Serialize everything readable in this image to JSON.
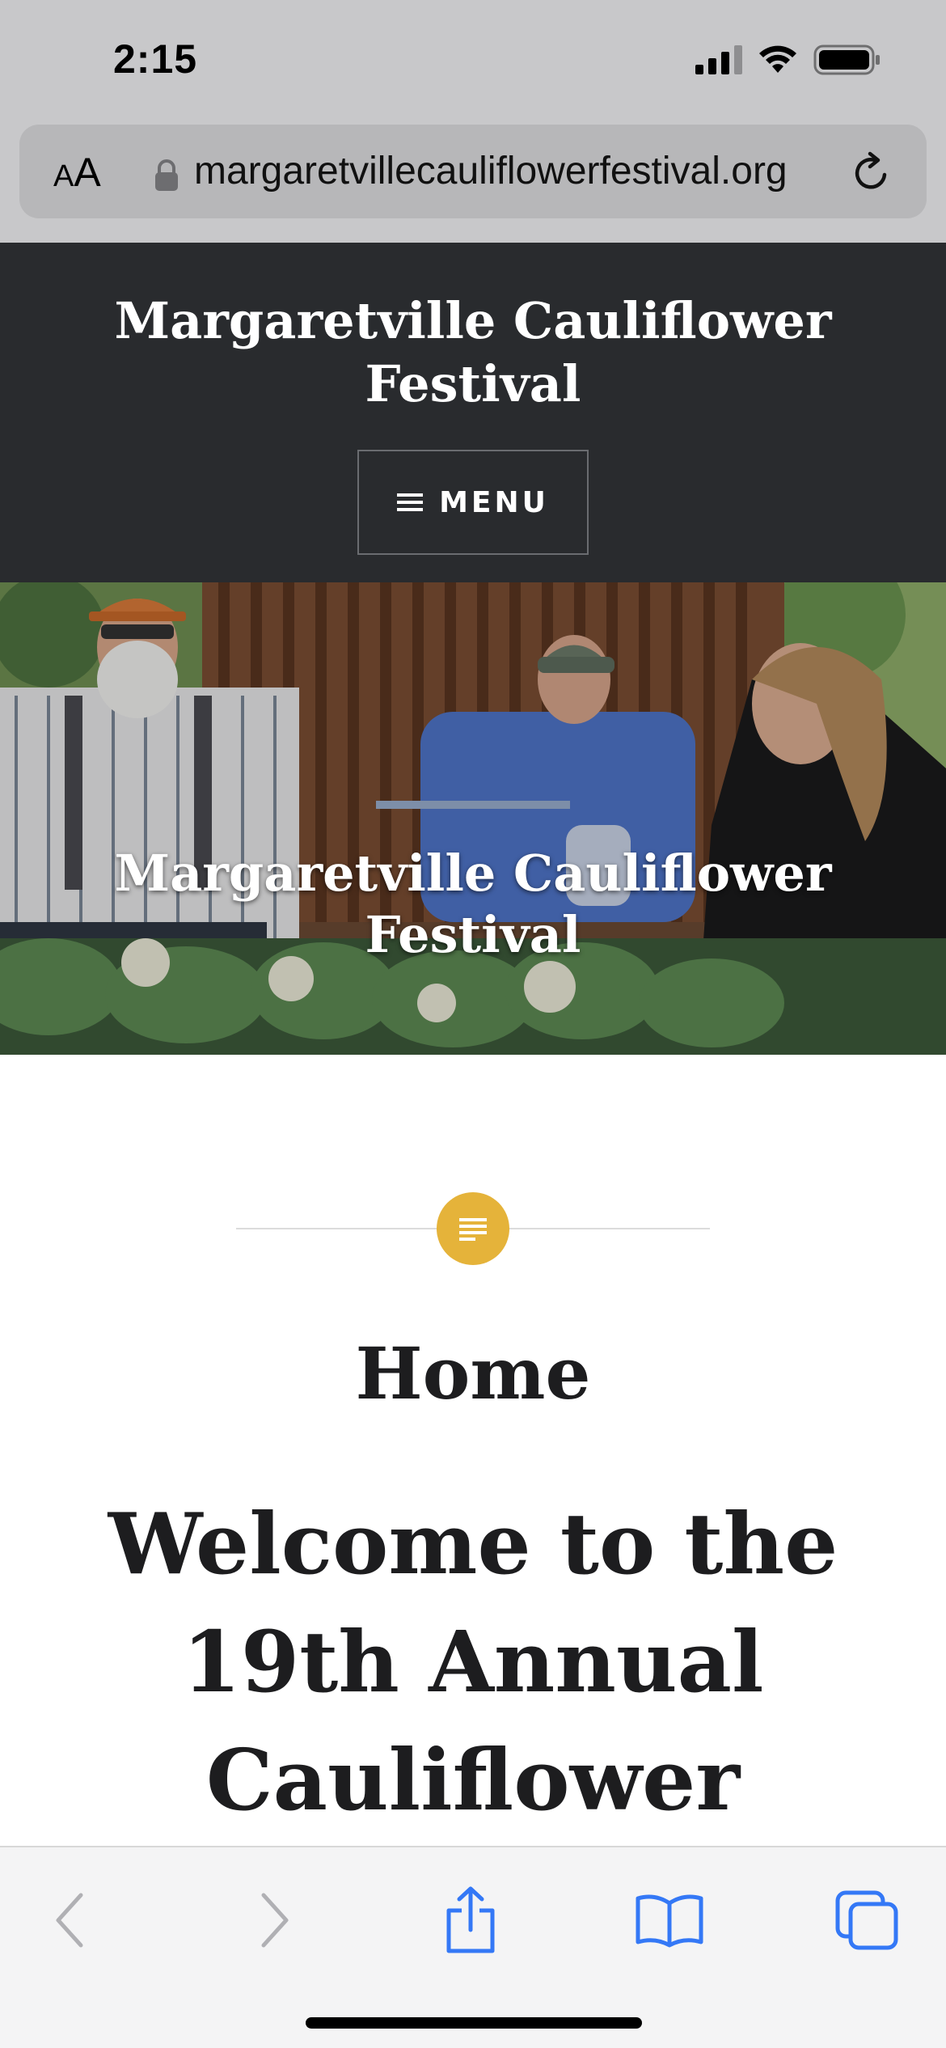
{
  "status_bar": {
    "time": "2:15",
    "icons": [
      "cellular-signal-icon",
      "wifi-icon",
      "battery-icon"
    ]
  },
  "browser": {
    "text_size_small": "A",
    "text_size_big": "A",
    "url": "margaretvillecauliflowerfestival.org",
    "icons": [
      "lock-icon",
      "reload-icon"
    ]
  },
  "site": {
    "title": "Margaretville Cauliflower Festival",
    "menu_label": "MENU",
    "menu_icon": "hamburger-icon"
  },
  "hero": {
    "title": "Margaretville Cauliflower Festival"
  },
  "page": {
    "title": "Home",
    "heading": "Welcome to the 19th Annual Cauliflower",
    "badge_icon": "document-icon"
  },
  "toolbar": {
    "icons": [
      "back-icon",
      "forward-icon",
      "share-icon",
      "bookmarks-icon",
      "tabs-icon"
    ]
  },
  "colors": {
    "header_bg": "#292b2e",
    "badge": "#e5b33a",
    "accent_line": "#7d8ea8",
    "toolbar_icon": "#3478f6",
    "toolbar_icon_disabled": "#b0b0b4"
  }
}
